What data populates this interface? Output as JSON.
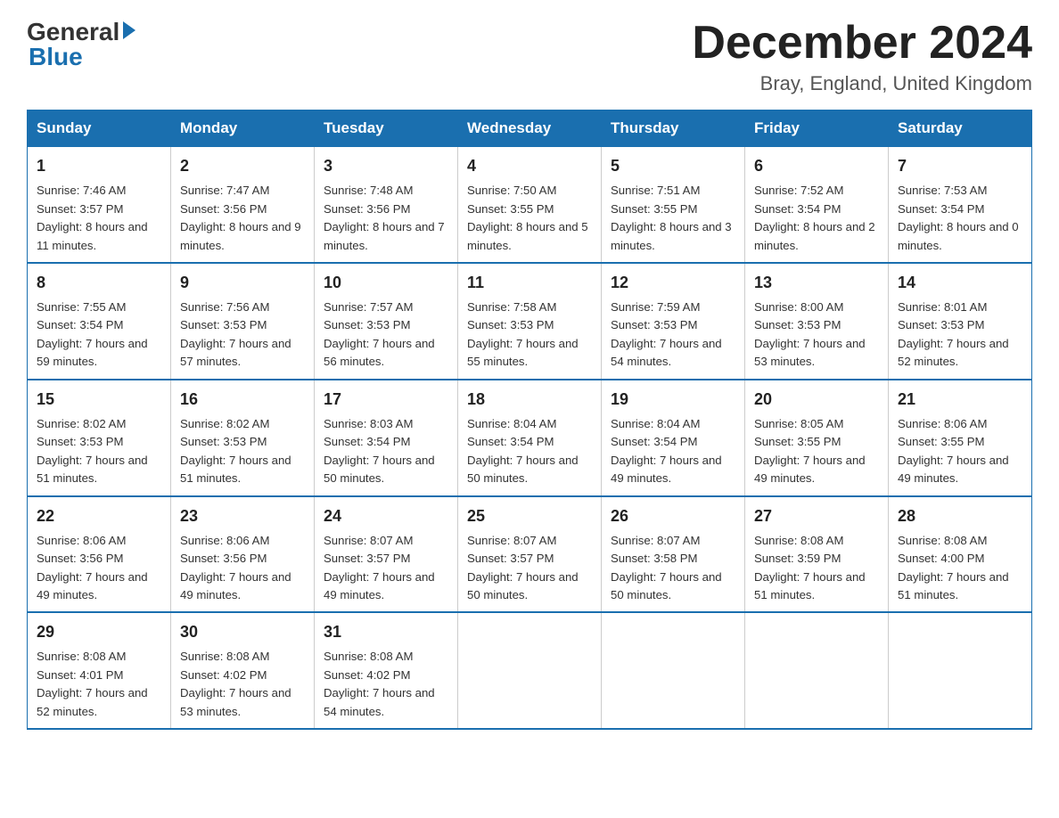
{
  "logo": {
    "general": "General",
    "blue": "Blue"
  },
  "title": {
    "month_year": "December 2024",
    "location": "Bray, England, United Kingdom"
  },
  "days_of_week": [
    "Sunday",
    "Monday",
    "Tuesday",
    "Wednesday",
    "Thursday",
    "Friday",
    "Saturday"
  ],
  "weeks": [
    [
      {
        "day": "1",
        "sunrise": "7:46 AM",
        "sunset": "3:57 PM",
        "daylight": "8 hours and 11 minutes."
      },
      {
        "day": "2",
        "sunrise": "7:47 AM",
        "sunset": "3:56 PM",
        "daylight": "8 hours and 9 minutes."
      },
      {
        "day": "3",
        "sunrise": "7:48 AM",
        "sunset": "3:56 PM",
        "daylight": "8 hours and 7 minutes."
      },
      {
        "day": "4",
        "sunrise": "7:50 AM",
        "sunset": "3:55 PM",
        "daylight": "8 hours and 5 minutes."
      },
      {
        "day": "5",
        "sunrise": "7:51 AM",
        "sunset": "3:55 PM",
        "daylight": "8 hours and 3 minutes."
      },
      {
        "day": "6",
        "sunrise": "7:52 AM",
        "sunset": "3:54 PM",
        "daylight": "8 hours and 2 minutes."
      },
      {
        "day": "7",
        "sunrise": "7:53 AM",
        "sunset": "3:54 PM",
        "daylight": "8 hours and 0 minutes."
      }
    ],
    [
      {
        "day": "8",
        "sunrise": "7:55 AM",
        "sunset": "3:54 PM",
        "daylight": "7 hours and 59 minutes."
      },
      {
        "day": "9",
        "sunrise": "7:56 AM",
        "sunset": "3:53 PM",
        "daylight": "7 hours and 57 minutes."
      },
      {
        "day": "10",
        "sunrise": "7:57 AM",
        "sunset": "3:53 PM",
        "daylight": "7 hours and 56 minutes."
      },
      {
        "day": "11",
        "sunrise": "7:58 AM",
        "sunset": "3:53 PM",
        "daylight": "7 hours and 55 minutes."
      },
      {
        "day": "12",
        "sunrise": "7:59 AM",
        "sunset": "3:53 PM",
        "daylight": "7 hours and 54 minutes."
      },
      {
        "day": "13",
        "sunrise": "8:00 AM",
        "sunset": "3:53 PM",
        "daylight": "7 hours and 53 minutes."
      },
      {
        "day": "14",
        "sunrise": "8:01 AM",
        "sunset": "3:53 PM",
        "daylight": "7 hours and 52 minutes."
      }
    ],
    [
      {
        "day": "15",
        "sunrise": "8:02 AM",
        "sunset": "3:53 PM",
        "daylight": "7 hours and 51 minutes."
      },
      {
        "day": "16",
        "sunrise": "8:02 AM",
        "sunset": "3:53 PM",
        "daylight": "7 hours and 51 minutes."
      },
      {
        "day": "17",
        "sunrise": "8:03 AM",
        "sunset": "3:54 PM",
        "daylight": "7 hours and 50 minutes."
      },
      {
        "day": "18",
        "sunrise": "8:04 AM",
        "sunset": "3:54 PM",
        "daylight": "7 hours and 50 minutes."
      },
      {
        "day": "19",
        "sunrise": "8:04 AM",
        "sunset": "3:54 PM",
        "daylight": "7 hours and 49 minutes."
      },
      {
        "day": "20",
        "sunrise": "8:05 AM",
        "sunset": "3:55 PM",
        "daylight": "7 hours and 49 minutes."
      },
      {
        "day": "21",
        "sunrise": "8:06 AM",
        "sunset": "3:55 PM",
        "daylight": "7 hours and 49 minutes."
      }
    ],
    [
      {
        "day": "22",
        "sunrise": "8:06 AM",
        "sunset": "3:56 PM",
        "daylight": "7 hours and 49 minutes."
      },
      {
        "day": "23",
        "sunrise": "8:06 AM",
        "sunset": "3:56 PM",
        "daylight": "7 hours and 49 minutes."
      },
      {
        "day": "24",
        "sunrise": "8:07 AM",
        "sunset": "3:57 PM",
        "daylight": "7 hours and 49 minutes."
      },
      {
        "day": "25",
        "sunrise": "8:07 AM",
        "sunset": "3:57 PM",
        "daylight": "7 hours and 50 minutes."
      },
      {
        "day": "26",
        "sunrise": "8:07 AM",
        "sunset": "3:58 PM",
        "daylight": "7 hours and 50 minutes."
      },
      {
        "day": "27",
        "sunrise": "8:08 AM",
        "sunset": "3:59 PM",
        "daylight": "7 hours and 51 minutes."
      },
      {
        "day": "28",
        "sunrise": "8:08 AM",
        "sunset": "4:00 PM",
        "daylight": "7 hours and 51 minutes."
      }
    ],
    [
      {
        "day": "29",
        "sunrise": "8:08 AM",
        "sunset": "4:01 PM",
        "daylight": "7 hours and 52 minutes."
      },
      {
        "day": "30",
        "sunrise": "8:08 AM",
        "sunset": "4:02 PM",
        "daylight": "7 hours and 53 minutes."
      },
      {
        "day": "31",
        "sunrise": "8:08 AM",
        "sunset": "4:02 PM",
        "daylight": "7 hours and 54 minutes."
      },
      null,
      null,
      null,
      null
    ]
  ],
  "labels": {
    "sunrise": "Sunrise:",
    "sunset": "Sunset:",
    "daylight": "Daylight:"
  }
}
